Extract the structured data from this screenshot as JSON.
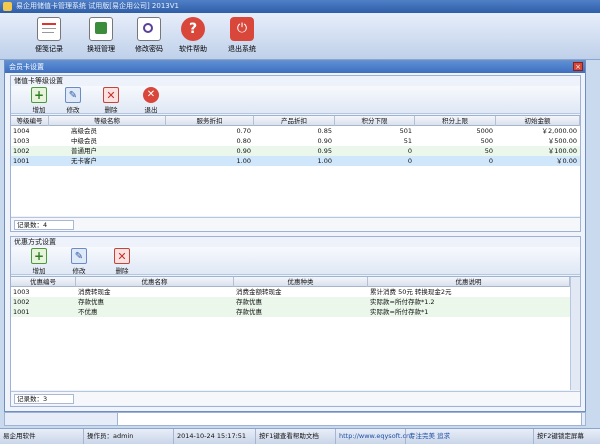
{
  "app": {
    "title": "易企用储值卡管理系统 试用版[易企用公司] 2013V1"
  },
  "toolbar": {
    "buttons": [
      {
        "label": "便笺记录",
        "icon": "note-icon",
        "color": "#2b2b2b"
      },
      {
        "label": "换班管理",
        "icon": "shift-icon",
        "color": "#3b8d3b"
      },
      {
        "label": "修改密码",
        "icon": "password-icon",
        "color": "#5a3f9a"
      },
      {
        "label": "软件帮助",
        "icon": "help-icon",
        "color": "#d9473a"
      },
      {
        "label": "退出系统",
        "icon": "power-icon",
        "color": "#d9473a"
      }
    ]
  },
  "dialog": {
    "title": "会员卡设置",
    "close_label": "×"
  },
  "level_group": {
    "title": "储值卡等级设置",
    "buttons": [
      {
        "label": "增加",
        "icon": "add-icon"
      },
      {
        "label": "修改",
        "icon": "edit-icon"
      },
      {
        "label": "删除",
        "icon": "delete-icon"
      },
      {
        "label": "退出",
        "icon": "exit-icon"
      }
    ],
    "columns": [
      "等级编号",
      "等级名称",
      "服务折扣",
      "产品折扣",
      "积分下限",
      "积分上限",
      "初始金额"
    ],
    "rows": [
      [
        "1004",
        "高级会员",
        "0.70",
        "0.85",
        "501",
        "5000",
        "￥2,000.00"
      ],
      [
        "1003",
        "中级会员",
        "0.80",
        "0.90",
        "51",
        "500",
        "￥500.00"
      ],
      [
        "1002",
        "普通用户",
        "0.90",
        "0.95",
        "0",
        "50",
        "￥100.00"
      ],
      [
        "1001",
        "无卡客户",
        "1.00",
        "1.00",
        "0",
        "0",
        "￥0.00"
      ]
    ],
    "record_count": "记录数：4"
  },
  "discount_group": {
    "title": "优惠方式设置",
    "buttons": [
      {
        "label": "增加",
        "icon": "add-icon"
      },
      {
        "label": "修改",
        "icon": "edit-icon"
      },
      {
        "label": "删除",
        "icon": "delete-icon"
      }
    ],
    "columns": [
      "优惠编号",
      "优惠名称",
      "优惠种类",
      "优惠说明"
    ],
    "rows": [
      [
        "1003",
        "消费转现金",
        "消费金额转现金",
        "累计消费 50元 转换现金2元"
      ],
      [
        "1002",
        "存款优惠",
        "存款优惠",
        "实际款=所付存款*1.2"
      ],
      [
        "1001",
        "不优惠",
        "存款优惠",
        "实际款=所付存款*1"
      ]
    ],
    "record_count": "记录数：3"
  },
  "statusbar": {
    "app_name": "易企用软件",
    "operator": "操作员：admin",
    "datetime": "2014-10-24 15:17:51",
    "help_text": "按F1键查看帮助文档",
    "url": "http://www.eqysoft.cn/",
    "slogan": "专注完美 追求",
    "lock_text": "按F2键锁定屏幕"
  }
}
